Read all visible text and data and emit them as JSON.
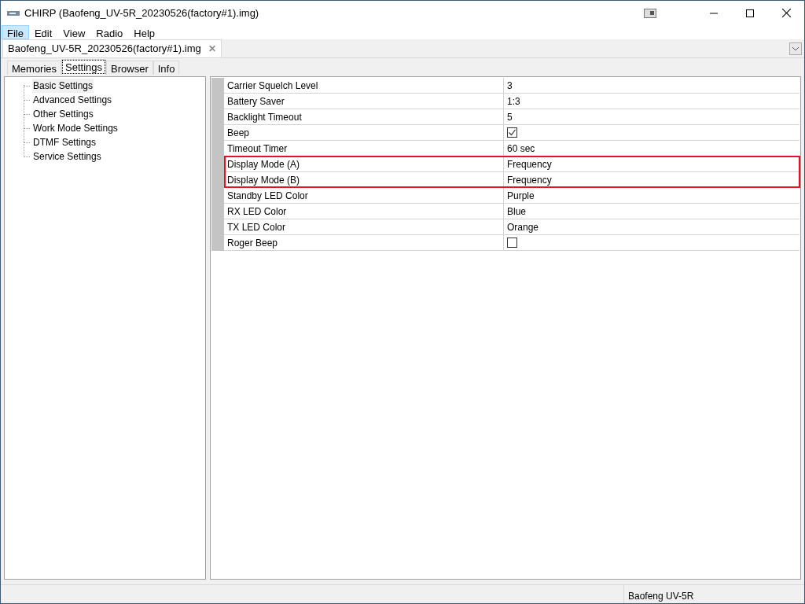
{
  "window": {
    "title": "CHIRP (Baofeng_UV-5R_20230526(factory#1).img)"
  },
  "menu": [
    {
      "label": "File",
      "selected": true
    },
    {
      "label": "Edit",
      "selected": false
    },
    {
      "label": "View",
      "selected": false
    },
    {
      "label": "Radio",
      "selected": false
    },
    {
      "label": "Help",
      "selected": false
    }
  ],
  "document_tab": {
    "label": "Baofeng_UV-5R_20230526(factory#1).img",
    "close": "✕"
  },
  "tabs": [
    {
      "label": "Memories",
      "selected": false
    },
    {
      "label": "Settings",
      "selected": true
    },
    {
      "label": "Browser",
      "selected": false
    },
    {
      "label": "Info",
      "selected": false
    }
  ],
  "tree": [
    {
      "label": "Basic Settings",
      "selected": true
    },
    {
      "label": "Advanced Settings",
      "selected": false
    },
    {
      "label": "Other Settings",
      "selected": false
    },
    {
      "label": "Work Mode Settings",
      "selected": false
    },
    {
      "label": "DTMF Settings",
      "selected": false
    },
    {
      "label": "Service Settings",
      "selected": false
    }
  ],
  "settings": [
    {
      "name": "Carrier Squelch Level",
      "kind": "text",
      "value": "3",
      "highlighted": false
    },
    {
      "name": "Battery Saver",
      "kind": "text",
      "value": "1:3",
      "highlighted": false
    },
    {
      "name": "Backlight Timeout",
      "kind": "text",
      "value": "5",
      "highlighted": false
    },
    {
      "name": "Beep",
      "kind": "checkbox",
      "checked": true,
      "highlighted": false
    },
    {
      "name": "Timeout Timer",
      "kind": "text",
      "value": "60 sec",
      "highlighted": false
    },
    {
      "name": "Display Mode (A)",
      "kind": "text",
      "value": "Frequency",
      "highlighted": true
    },
    {
      "name": "Display Mode (B)",
      "kind": "text",
      "value": "Frequency",
      "highlighted": true
    },
    {
      "name": "Standby LED Color",
      "kind": "text",
      "value": "Purple",
      "highlighted": false
    },
    {
      "name": "RX LED Color",
      "kind": "text",
      "value": "Blue",
      "highlighted": false
    },
    {
      "name": "TX LED Color",
      "kind": "text",
      "value": "Orange",
      "highlighted": false
    },
    {
      "name": "Roger Beep",
      "kind": "checkbox",
      "checked": false,
      "highlighted": false
    }
  ],
  "status_bar": {
    "radio": "Baofeng UV-5R"
  }
}
